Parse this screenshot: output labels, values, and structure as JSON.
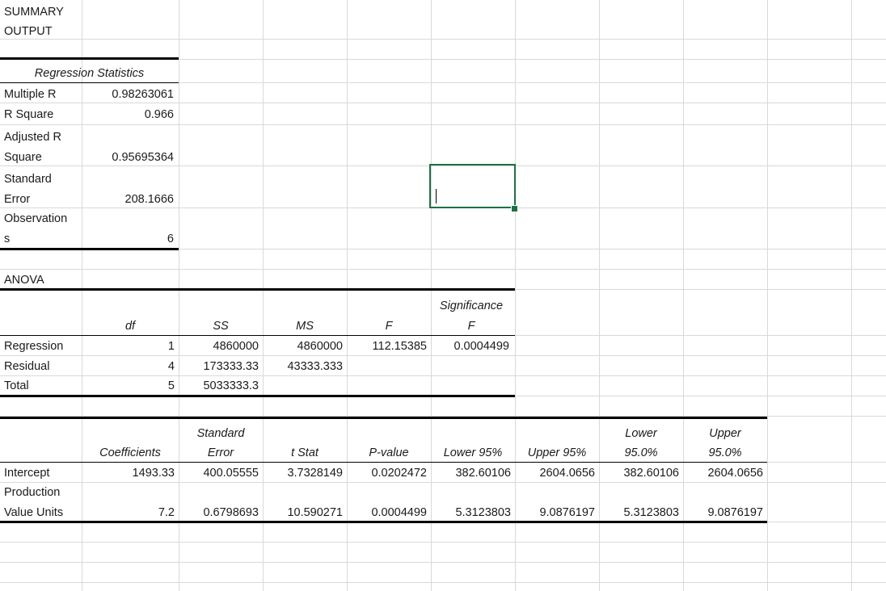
{
  "summary": {
    "title_line1": "SUMMARY",
    "title_line2": "OUTPUT"
  },
  "regression_statistics": {
    "header": "Regression Statistics",
    "rows": [
      {
        "label_lines": [
          "Multiple R"
        ],
        "value": "0.98263061"
      },
      {
        "label_lines": [
          "R Square"
        ],
        "value": "0.966"
      },
      {
        "label_lines": [
          "Adjusted R",
          "Square"
        ],
        "value": "0.95695364"
      },
      {
        "label_lines": [
          "Standard",
          "Error"
        ],
        "value": "208.1666"
      },
      {
        "label_lines": [
          "Observation",
          "s"
        ],
        "value": "6"
      }
    ]
  },
  "anova": {
    "title": "ANOVA",
    "headers": {
      "df": "df",
      "ss": "SS",
      "ms": "MS",
      "f": "F",
      "significance_f_line1": "Significance",
      "significance_f_line2": "F"
    },
    "rows": [
      {
        "label": "Regression",
        "df": "1",
        "ss": "4860000",
        "ms": "4860000",
        "f": "112.15385",
        "significance_f": "0.0004499"
      },
      {
        "label": "Residual",
        "df": "4",
        "ss": "173333.33",
        "ms": "43333.333",
        "f": "",
        "significance_f": ""
      },
      {
        "label": "Total",
        "df": "5",
        "ss": "5033333.3",
        "ms": "",
        "f": "",
        "significance_f": ""
      }
    ]
  },
  "coefficients": {
    "headers": {
      "coefficients": "Coefficients",
      "standard_error_line1": "Standard",
      "standard_error_line2": "Error",
      "t_stat": "t Stat",
      "p_value": "P-value",
      "lower_95": "Lower 95%",
      "upper_95": "Upper 95%",
      "lower_950_line1": "Lower",
      "lower_950_line2": "95.0%",
      "upper_950_line1": "Upper",
      "upper_950_line2": "95.0%"
    },
    "rows": [
      {
        "label_lines": [
          "Intercept"
        ],
        "coefficient": "1493.33",
        "standard_error": "400.05555",
        "t_stat": "3.7328149",
        "p_value": "0.0202472",
        "lower_95": "382.60106",
        "upper_95": "2604.0656",
        "lower_950": "382.60106",
        "upper_950": "2604.0656"
      },
      {
        "label_lines": [
          "Production",
          "Value Units"
        ],
        "coefficient": "7.2",
        "standard_error": "0.6798693",
        "t_stat": "10.590271",
        "p_value": "0.0004499",
        "lower_95": "5.3123803",
        "upper_95": "9.0876197",
        "lower_950": "5.3123803",
        "upper_950": "9.0876197"
      }
    ]
  },
  "selection": {
    "active_cell_value": ""
  },
  "colors": {
    "gridline": "#d9d9d9",
    "rule": "#000000",
    "selection": "#1e7145"
  }
}
